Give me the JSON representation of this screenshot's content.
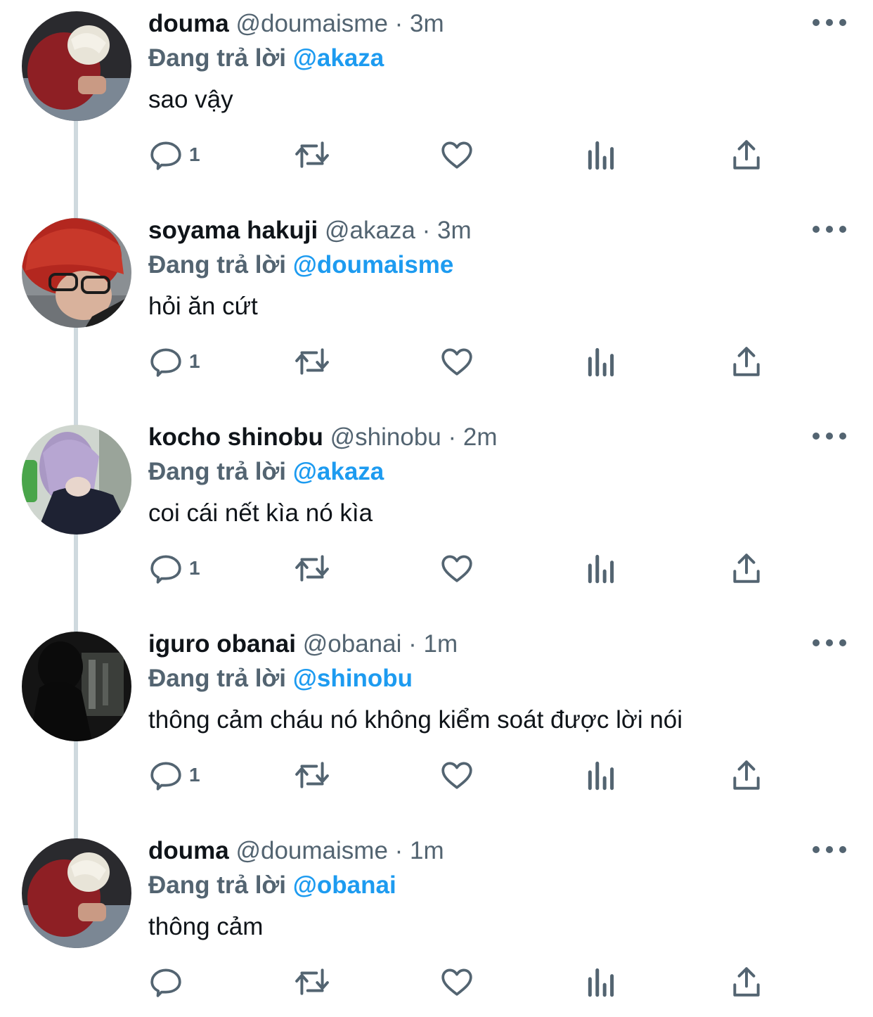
{
  "tweets": [
    {
      "name": "douma",
      "handle": "@doumaisme",
      "separator": "·",
      "time": "3m",
      "replying_label": "Đang trả lời",
      "replying_to": "@akaza",
      "text": "sao vậy",
      "reply_count": "1",
      "avatar": "avatar-douma"
    },
    {
      "name": "soyama hakuji",
      "handle": "@akaza",
      "separator": "·",
      "time": "3m",
      "replying_label": "Đang trả lời",
      "replying_to": "@doumaisme",
      "text": "hỏi ăn cứt",
      "reply_count": "1",
      "avatar": "avatar-akaza"
    },
    {
      "name": "kocho shinobu",
      "handle": "@shinobu",
      "separator": "·",
      "time": "2m",
      "replying_label": "Đang trả lời",
      "replying_to": "@akaza",
      "text": "coi cái nết kìa nó kìa",
      "reply_count": "1",
      "avatar": "avatar-shinobu"
    },
    {
      "name": "iguro obanai",
      "handle": "@obanai",
      "separator": "·",
      "time": "1m",
      "replying_label": "Đang trả lời",
      "replying_to": "@shinobu",
      "text": "thông cảm cháu nó không kiểm soát được lời nói",
      "reply_count": "1",
      "avatar": "avatar-obanai"
    },
    {
      "name": "douma",
      "handle": "@doumaisme",
      "separator": "·",
      "time": "1m",
      "replying_label": "Đang trả lời",
      "replying_to": "@obanai",
      "text": "thông cảm",
      "reply_count": "",
      "avatar": "avatar-douma"
    }
  ],
  "icons": {
    "reply": "reply-icon",
    "retweet": "retweet-icon",
    "like": "heart-icon",
    "views": "analytics-icon",
    "share": "share-icon",
    "more": "more-icon"
  },
  "colors": {
    "text": "#0f1419",
    "secondary": "#536471",
    "mention": "#1d9bf0",
    "thread_line": "#cfd9de"
  }
}
